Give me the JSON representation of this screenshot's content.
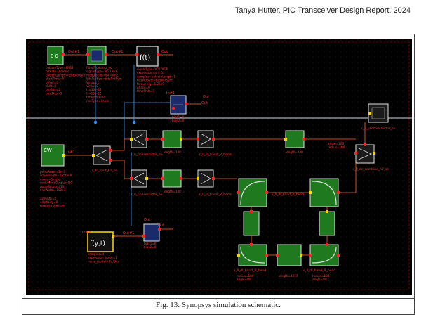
{
  "header": {
    "text": "Tanya Hutter, PIC Transceiver Design Report, 2024"
  },
  "caption": "Fig. 13: Synopsys simulation schematic.",
  "schematic": {
    "ports": {
      "out1_a": "Out#1",
      "in1_a": "In#1",
      "out_a": "Out",
      "out2_a": "Out#1",
      "out_b": "Out",
      "out_c": "Out",
      "in_top": "In#1",
      "out_mid": "Out",
      "out3": "Out#1",
      "in_bot": "In#2",
      "out_bot": "Out",
      "ft_label": "f(t)",
      "fyt_label": "f(y,t)",
      "cw_label": "CW"
    },
    "params": {
      "prbs": [
        "patternType=PRBS",
        "bitRate=bitRate",
        "patternLength=patternLen",
        "startTime=0",
        "offset=0",
        "shift=0",
        "preBits=2",
        "postBits=3"
      ],
      "pulse": [
        "filterType=nrz_eq",
        "signalType=VOLTAGE",
        "modulationType=NRZ",
        "bitsPerSym=bitsPerSym",
        "Vmax=1",
        "Vmin=0",
        "tr=10e-12",
        "tf=10e-12",
        "timeJitter=0",
        "riseType=linear"
      ],
      "ft": [
        "signalType=VOLTAGE",
        "expression=sin_fcl",
        "samples=patternLength-1",
        "bitsPerSym=bitsPerSym",
        "frequency=1.25e9",
        "phase=0",
        "timeShift=0"
      ],
      "laser": [
        "peakPower=1e-3",
        "wavelength=1550e-9",
        "mode=Single",
        "multiModeOutput=NO",
        "noiseSource=10",
        "lineWidth=100e3"
      ],
      "laser2": [
        "azimuth=0",
        "ellipticity=0",
        "format=Sym=ec"
      ],
      "adder_top": [
        "bias1=0",
        "bias2=0"
      ],
      "adder_bot": [
        "bias1=0",
        "bias2=0"
      ],
      "fyt": [
        "samples=4",
        "expression_noise=1",
        "noise_model=StdDev"
      ],
      "bend1": [
        "radius=100",
        "angle=90"
      ],
      "bend2": [
        "radius=100",
        "angle=90"
      ],
      "bend3": [
        "radius=100",
        "angle=90"
      ],
      "wg1": [
        "length=100"
      ],
      "wg2": [
        "length=100"
      ],
      "wg3": [
        "length=100"
      ],
      "wg4": [
        "length=4217"
      ],
      "wg5": [
        "length=100"
      ],
      "ang": [
        "angle=100",
        "radius=100"
      ]
    },
    "component_names": {
      "splitter": "i_dc_split_h1_se",
      "ps_top": "r_lI_phaseshifter_se",
      "ps_bot": "r_lI_phaseshifter_se",
      "bend_top": "r_lI_dl_band_R_bend",
      "bend_bot": "r_lI_dl_band_R_bend",
      "combiner": "r_lI_dc_combine_h2_se",
      "detector": "r_li_photodetector_se",
      "bend_l": "s_lI_dl_band_R_bend",
      "bend_r": "s_lI_dl_band_R_bend",
      "bend_b1": "s_lI_dl_band_R_bend",
      "bend_b2": "s_lI_dl_band_R_bend"
    },
    "colors": {
      "background": "#000000",
      "grid": "#3a3a3a",
      "wire": "#ff6633",
      "block_fill": "#1f7a1f",
      "block_stroke": "#e0e0e0",
      "text": "#ff3333",
      "port": "#ffd700",
      "pin_red": "#ff2222",
      "pin_blue": "#3399ff"
    }
  }
}
